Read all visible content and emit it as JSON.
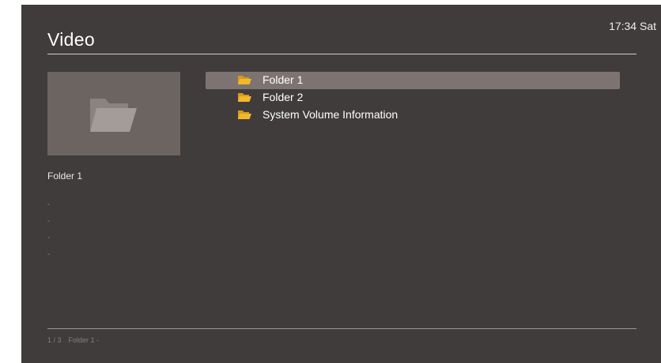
{
  "header": {
    "title": "Video",
    "clock": "17:34 Sat"
  },
  "preview": {
    "icon": "folder-icon",
    "name": "Folder 1",
    "details": [
      "-",
      "-",
      "-",
      "-"
    ]
  },
  "files": [
    {
      "label": "Folder 1",
      "icon": "folder-icon",
      "selected": true
    },
    {
      "label": "Folder 2",
      "icon": "folder-icon",
      "selected": false
    },
    {
      "label": "System Volume Information",
      "icon": "folder-icon",
      "selected": false
    }
  ],
  "footer": {
    "position": "1 / 3",
    "path": "Folder 1 -"
  },
  "colors": {
    "background": "#403c3c",
    "selection": "#7d7472",
    "folder": "#f2b82a"
  }
}
